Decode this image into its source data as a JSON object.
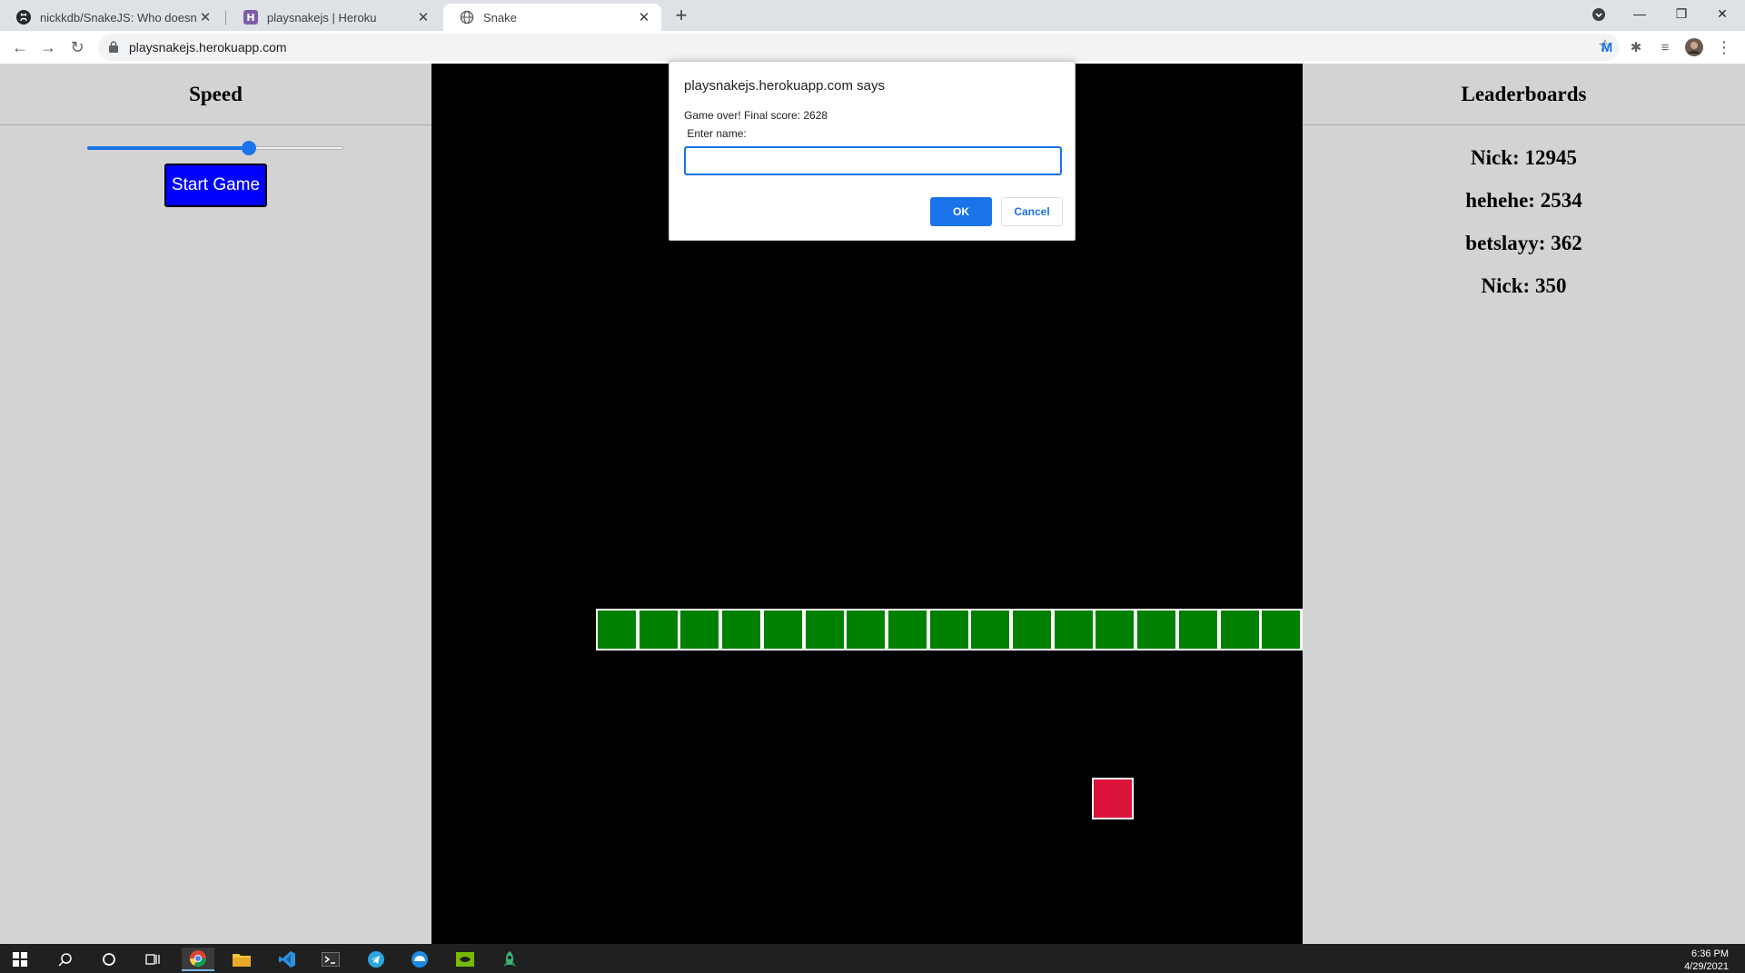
{
  "browser": {
    "tabs": [
      {
        "title": "nickkdb/SnakeJS: Who doesn't lo",
        "icon": "github-icon",
        "active": false
      },
      {
        "title": "playsnakejs | Heroku",
        "icon": "heroku-icon",
        "active": false
      },
      {
        "title": "Snake",
        "icon": "globe-icon",
        "active": true
      }
    ],
    "new_tab_label": "+",
    "url": "playsnakejs.herokuapp.com"
  },
  "left_panel": {
    "title": "Speed",
    "speed_value": 0.63,
    "start_button_label": "Start Game"
  },
  "right_panel": {
    "title": "Leaderboards",
    "entries": [
      "Nick: 12945",
      "hehehe: 2534",
      "betslayy: 362",
      "Nick: 350"
    ]
  },
  "game": {
    "snake_segment_count": 18,
    "food_color": "#dc143c",
    "snake_color": "#008000"
  },
  "dialog": {
    "title": "playsnakejs.herokuapp.com says",
    "message_line1": "Game over! Final score: 2628",
    "message_line2": " Enter name:",
    "input_value": "",
    "ok_label": "OK",
    "cancel_label": "Cancel"
  },
  "taskbar": {
    "time": "6:36 PM",
    "date": "4/29/2021"
  },
  "colors": {
    "accent": "#1a73e8",
    "start_button": "#0000ff",
    "panel_bg": "#d3d3d3",
    "board_bg": "#000000"
  }
}
